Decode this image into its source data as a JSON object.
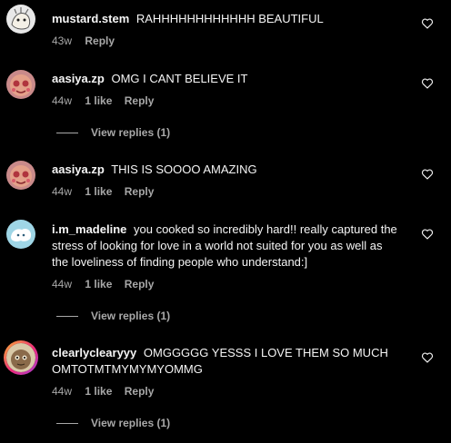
{
  "comments": [
    {
      "username": "mustard.stem",
      "text": "RAHHHHHHHHHHHH BEAUTIFUL",
      "time": "43w",
      "likes": "",
      "reply": "Reply"
    },
    {
      "username": "aasiya.zp",
      "text": "OMG I CANT BELIEVE IT",
      "time": "44w",
      "likes": "1 like",
      "reply": "Reply",
      "view_replies": "View replies (1)"
    },
    {
      "username": "aasiya.zp",
      "text": "THIS IS SOOOO AMAZING",
      "time": "44w",
      "likes": "1 like",
      "reply": "Reply"
    },
    {
      "username": "i.m_madeline",
      "text": "you cooked so incredibly hard!! really captured the stress of looking for love in a world not suited for you as well as the loveliness of finding people who understand:]",
      "time": "44w",
      "likes": "1 like",
      "reply": "Reply",
      "view_replies": "View replies (1)"
    },
    {
      "username": "clearlyclearyyy",
      "text": "OMGGGGG YESSS I LOVE THEM SO MUCH OMTOTMTMYMYMYOMMG",
      "time": "44w",
      "likes": "1 like",
      "reply": "Reply",
      "view_replies": "View replies (1)"
    }
  ],
  "icons": {
    "like": "heart-outline-icon",
    "avatar": "profile-picture"
  },
  "colors": {
    "background": "#000000",
    "primary_text": "#f5f5f5",
    "secondary_text": "#a8a8a8"
  }
}
